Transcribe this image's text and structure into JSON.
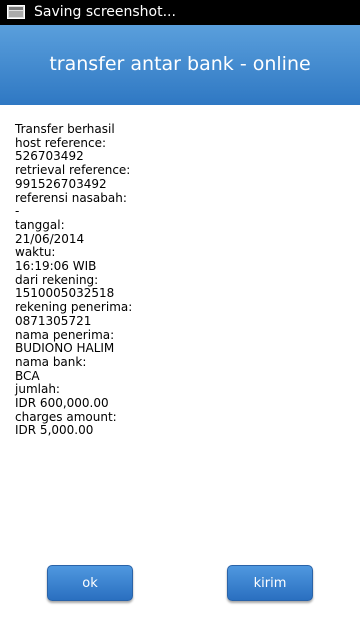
{
  "status_bar": {
    "icon": "screenshot-icon",
    "text": "Saving screenshot..."
  },
  "header": {
    "title": "transfer antar bank - online"
  },
  "details": {
    "lines": [
      "Transfer berhasil",
      "host reference:",
      "526703492",
      "retrieval reference:",
      "991526703492",
      "referensi nasabah:",
      "-",
      "tanggal:",
      "21/06/2014",
      "waktu:",
      "16:19:06 WIB",
      "dari rekening:",
      "1510005032518",
      "rekening penerima:",
      "0871305721",
      "nama penerima:",
      "BUDIONO HALIM",
      "nama bank:",
      "BCA",
      "jumlah:",
      "IDR 600,000.00",
      "charges amount:",
      "IDR 5,000.00"
    ]
  },
  "buttons": {
    "ok": "ok",
    "kirim": "kirim"
  },
  "colors": {
    "header_bg": "#3f88d0",
    "button_bg": "#3a82cf",
    "status_bar_bg": "#000000"
  }
}
